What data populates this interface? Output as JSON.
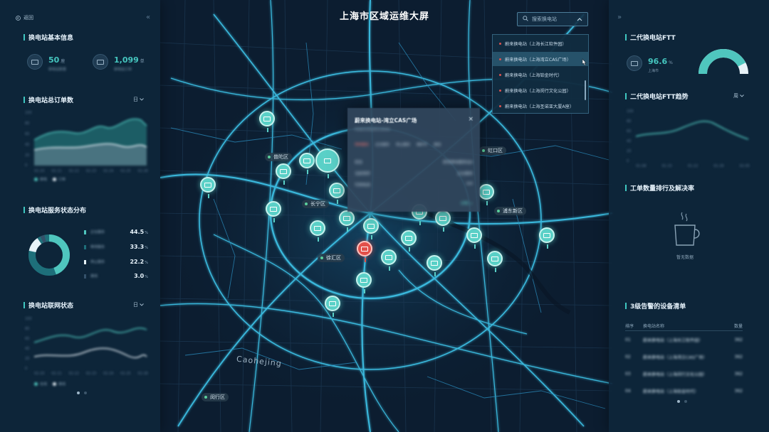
{
  "app": {
    "title": "上海市区域运维大屏",
    "back_label": "返回",
    "collapse_left": "«",
    "collapse_right": "»"
  },
  "search": {
    "placeholder": "搜索换电站",
    "items": [
      "蔚来换电站（上海长江软件园）",
      "蔚来换电站（上海湾立CAS广场）",
      "蔚来换电站（上海铂金时代）",
      "蔚来换电站（上海闵行文化公园）",
      "蔚来换电站（上海圣诺亚大厦A座）"
    ],
    "active_index": 1
  },
  "left": {
    "basic_info": {
      "title": "换电站基本信息",
      "kpis": [
        {
          "value": "50",
          "unit": "座",
          "label": "换电站数量"
        },
        {
          "value": "1,099",
          "unit": "单",
          "label": "换电站订单"
        }
      ]
    },
    "orders": {
      "title": "换电站总订单数",
      "selector": "日",
      "y_ticks": [
        "100",
        "80",
        "60",
        "40",
        "20",
        "0"
      ],
      "x_ticks": [
        "02-20",
        "02-21",
        "02-22",
        "02-23",
        "02-24",
        "02-25",
        "02-26"
      ],
      "legend": [
        "换电",
        "订单"
      ]
    },
    "status": {
      "title": "换电站服务状态分布",
      "rows": [
        {
          "label": "正在服务",
          "pct": "44.5",
          "color": "#4fc6be"
        },
        {
          "label": "等待服务",
          "pct": "33.3",
          "color": "#1e6f7a"
        },
        {
          "label": "停止服务",
          "pct": "22.2",
          "color": "#e7f3f9"
        },
        {
          "label": "离线",
          "pct": "3.0",
          "color": "#34516a"
        }
      ],
      "pct_unit": "%"
    },
    "network": {
      "title": "换电站联网状态",
      "selector": "日",
      "y_ticks": [
        "100",
        "80",
        "60",
        "40",
        "20",
        "0"
      ],
      "x_ticks": [
        "02-20",
        "02-21",
        "02-22",
        "02-23",
        "02-24",
        "02-25",
        "02-26"
      ],
      "legend": [
        "在线",
        "离线"
      ]
    }
  },
  "right": {
    "ftt": {
      "title": "二代换电站FTT",
      "value": "96.6",
      "unit": "%",
      "label": "上海市",
      "gauge_fraction": 0.85
    },
    "ftt_trend": {
      "title": "二代换电站FTT趋势",
      "selector": "周",
      "y_ticks": [
        "100",
        "80",
        "60",
        "40",
        "20",
        "0"
      ],
      "x_ticks": [
        "01-08",
        "01-15",
        "01-22",
        "01-29",
        "02-05"
      ]
    },
    "ticket_rank": {
      "title": "工单数量排行及解决率",
      "empty_text": "暂无数据"
    },
    "alarm_list": {
      "title": "3级告警的设备清单",
      "headers": [
        "排序",
        "换电站名称",
        "数量"
      ],
      "rows": [
        {
          "rank": "01",
          "name": "蔚来换电站（上海长江软件园）",
          "count": "362"
        },
        {
          "rank": "02",
          "name": "蔚来换电站（上海湾立CAS广场）",
          "count": "362"
        },
        {
          "rank": "03",
          "name": "蔚来换电站（上海闵行文化公园）",
          "count": "362"
        },
        {
          "rank": "04",
          "name": "蔚来换电站（上海铂金时代）",
          "count": "362"
        }
      ]
    }
  },
  "map": {
    "popup": {
      "title": "蔚来换电站-湾立CAS广场",
      "subtitle": "PSNIOVIRDES19040",
      "tabs": [
        "待命服务",
        "正在服务",
        "停止服务",
        "维护中",
        "离线"
      ],
      "rows": [
        {
          "k": "状态",
          "v": "蔚来换电服务站6"
        },
        {
          "k": "当前排序",
          "v": "正在服务"
        },
        {
          "k": "可用电池",
          "v": "6/6"
        }
      ],
      "link": "详情 >"
    },
    "districts": [
      "普陀区",
      "长宁区",
      "徐汇区",
      "闵行区",
      "浦东新区",
      "虹口区"
    ],
    "area_label": "Caohejing"
  }
}
